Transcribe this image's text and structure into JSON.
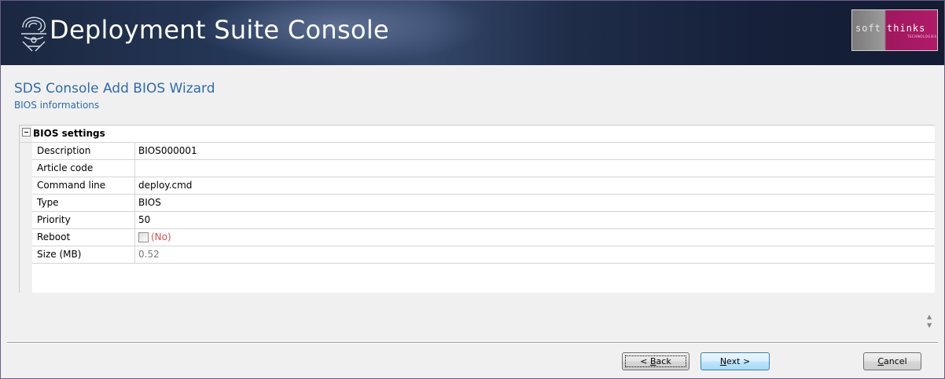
{
  "header": {
    "app_title": "Deployment Suite Console",
    "brand_soft": "soft",
    "brand_thinks": "thinks",
    "brand_tagline": "TECHNOLOGIES"
  },
  "wizard": {
    "title": "SDS Console Add BIOS Wizard",
    "subtitle": "BIOS informations"
  },
  "grid": {
    "group_label": "BIOS settings",
    "rows": [
      {
        "name": "Description",
        "value": "BIOS000001"
      },
      {
        "name": "Article code",
        "value": ""
      },
      {
        "name": "Command line",
        "value": "deploy.cmd"
      },
      {
        "name": "Type",
        "value": "BIOS"
      },
      {
        "name": "Priority",
        "value": "50"
      },
      {
        "name": "Reboot",
        "value": "(No)",
        "checked": false
      },
      {
        "name": "Size (MB)",
        "value": "0.52"
      }
    ]
  },
  "buttons": {
    "back_prefix": "< ",
    "back_key": "B",
    "back_rest": "ack",
    "next_key": "N",
    "next_rest": "ext >",
    "cancel_key": "C",
    "cancel_rest": "ancel"
  },
  "scroll": {
    "up": "▲",
    "down": "▼"
  },
  "colors": {
    "accent": "#2d6bb0",
    "reboot_value": "#e24b4b",
    "banner_dark": "#16203a"
  }
}
